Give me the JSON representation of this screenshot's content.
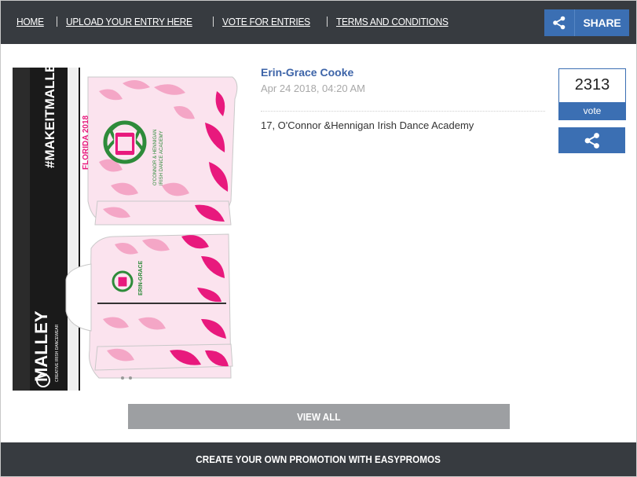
{
  "nav": {
    "items": [
      "HOME",
      "UPLOAD YOUR ENTRY HERE",
      "VOTE FOR ENTRIES",
      "TERMS AND CONDITIONS"
    ],
    "share_label": "SHARE"
  },
  "entry": {
    "name": "Erin-Grace Cooke",
    "date": "Apr 24 2018, 04:20 AM",
    "description": "17, O'Connor &Hennigan Irish Dance Academy",
    "votes": "2313",
    "vote_label": "vote",
    "image": {
      "hashtag": "#MAKEITMALLEY",
      "brand": "MALLEY",
      "brand_tagline": "CREATIVE IRISH DANCEWEAR",
      "event": "FLORIDA 2018",
      "academy_line1": "O'CONNOR & HENNIGAN",
      "academy_line2": "IRISH DANCE ACADEMY",
      "name_on_jacket": "ERIN-GRACE"
    }
  },
  "view_all_label": "VIEW ALL",
  "footer_text": "CREATE YOUR OWN PROMOTION WITH EASYPROMOS",
  "colors": {
    "nav_bg": "#373b40",
    "accent_blue": "#3b6fb3",
    "link_blue": "#3d64a8",
    "pink": "#e8197d",
    "light_pink": "#f6c9dc",
    "green": "#2e8b3a",
    "view_all_gray": "#9d9fa2"
  }
}
